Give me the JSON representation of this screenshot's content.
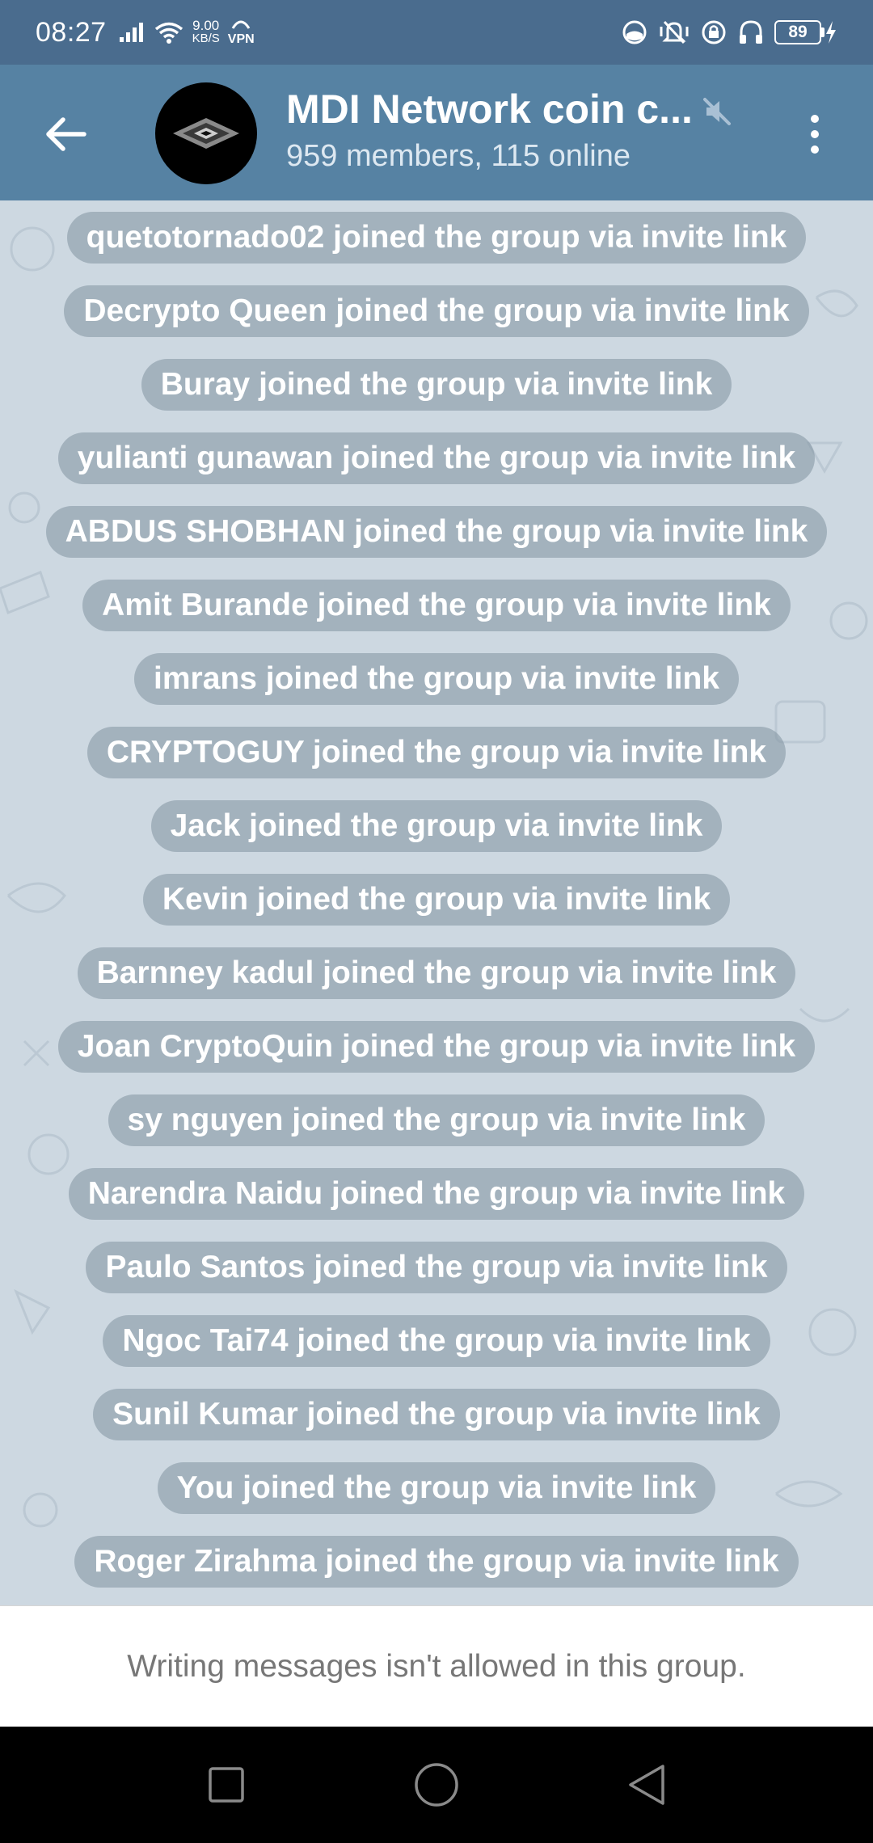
{
  "status_bar": {
    "time": "08:27",
    "net_speed_value": "9.00",
    "net_speed_unit": "KB/S",
    "vpn_label": "VPN",
    "battery_level": "89"
  },
  "header": {
    "title": "MDI Network coin c...",
    "subtitle": "959 members, 115 online"
  },
  "messages": [
    {
      "text": "quetotornado02 joined the group via invite link"
    },
    {
      "text": "Decrypto Queen joined the group via invite link"
    },
    {
      "text": "Buray joined the group via invite link"
    },
    {
      "text": "yulianti gunawan joined the group via invite link"
    },
    {
      "text": "ABDUS SHOBHAN joined the group via invite link"
    },
    {
      "text": "Amit Burande joined the group via invite link"
    },
    {
      "text": "imrans joined the group via invite link"
    },
    {
      "text": "CRYPTOGUY joined the group via invite link"
    },
    {
      "text": "Jack joined the group via invite link"
    },
    {
      "text": "Kevin joined the group via invite link"
    },
    {
      "text": "Barnney kadul joined the group via invite link"
    },
    {
      "text": "Joan CryptoQuin joined the group via invite link"
    },
    {
      "text": "sy nguyen joined the group via invite link"
    },
    {
      "text": "Narendra Naidu joined the group via invite link"
    },
    {
      "text": "Paulo Santos joined the group via invite link"
    },
    {
      "text": "Ngoc Tai74 joined the group via invite link"
    },
    {
      "text": "Sunil Kumar joined the group via invite link"
    },
    {
      "text": "You joined the group via invite link"
    },
    {
      "text": "Roger Zirahma joined the group via invite link"
    }
  ],
  "bottom_notice": {
    "text": "Writing messages isn't allowed in this group."
  },
  "colors": {
    "status_bar_bg": "#4a6c8e",
    "header_bg": "#5682a3",
    "chat_bg": "#cdd8e1",
    "service_bubble": "#8d9ca8"
  },
  "icons": {
    "back": "arrow-left-icon",
    "mute": "muted-speaker-icon",
    "menu": "more-vertical-icon",
    "nav_recents": "square-icon",
    "nav_home": "circle-icon",
    "nav_back": "triangle-back-icon"
  }
}
